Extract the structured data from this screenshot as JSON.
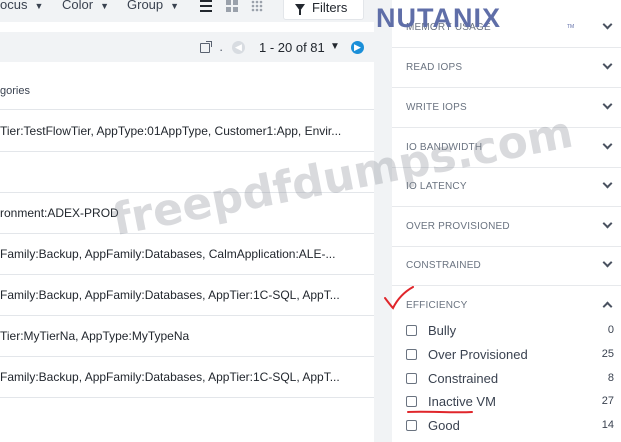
{
  "toolbar": {
    "focus_label": "ocus",
    "color_label": "Color",
    "group_label": "Group",
    "filters_label": "Filters"
  },
  "pager": {
    "separator": "·",
    "range": "1 - 20 of 81"
  },
  "table": {
    "header": "gories",
    "rows": [
      "Tier:TestFlowTier, AppType:01AppType, Customer1:App, Envir...",
      "",
      "ronment:ADEX-PROD",
      "Family:Backup, AppFamily:Databases, CalmApplication:ALE-...",
      "Family:Backup, AppFamily:Databases, AppTier:1C-SQL, AppT...",
      "Tier:MyTierNa, AppType:MyTypeNa",
      "Family:Backup, AppFamily:Databases, AppTier:1C-SQL, AppT..."
    ]
  },
  "filters_panel": {
    "sections": [
      "MEMORY USAGE",
      "READ IOPS",
      "WRITE IOPS",
      "IO BANDWIDTH",
      "IO LATENCY",
      "OVER PROVISIONED",
      "CONSTRAINED",
      "EFFICIENCY"
    ],
    "efficiency_options": [
      {
        "label": "Bully",
        "count": "0"
      },
      {
        "label": "Over Provisioned",
        "count": "25"
      },
      {
        "label": "Constrained",
        "count": "8"
      },
      {
        "label": "Inactive VM",
        "count": "27"
      },
      {
        "label": "Good",
        "count": "14"
      }
    ]
  },
  "logo": {
    "text": "NUTANIX",
    "tm": "TM"
  },
  "watermark": {
    "text": "freepdfdumps.com"
  },
  "colors": {
    "accent_blue": "#1b8fd8",
    "annotation_red": "#e0262b",
    "logo": "#5f6ea8"
  }
}
